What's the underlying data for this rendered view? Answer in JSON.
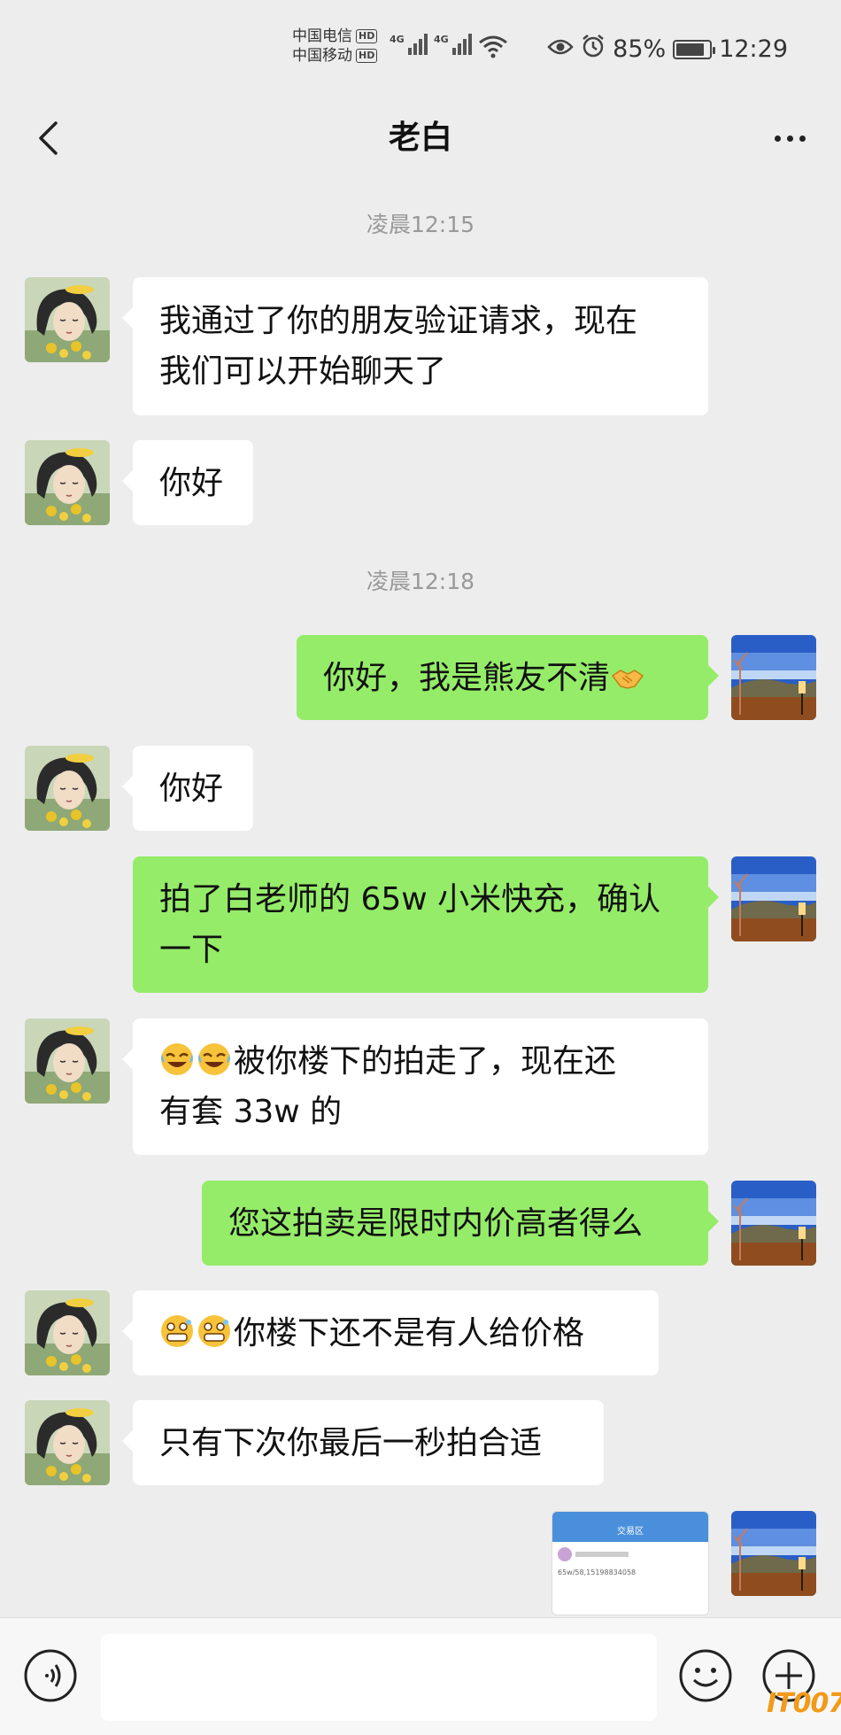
{
  "status_bar": {
    "carrier1": "中国电信",
    "carrier2": "中国移动",
    "hd_badge": "HD",
    "network": "4G",
    "battery": "85%",
    "battery_level": 0.85,
    "time": "12:29"
  },
  "header": {
    "title": "老白"
  },
  "messages": [
    {
      "type": "time",
      "text": "凌晨12:15"
    },
    {
      "type": "in",
      "text": "我通过了你的朋友验证请求，现在\n我们可以开始聊天了"
    },
    {
      "type": "in",
      "text": "你好"
    },
    {
      "type": "time",
      "text": "凌晨12:18"
    },
    {
      "type": "out",
      "text": "你好，我是熊友不清",
      "emoji_after": "handshake-emoji"
    },
    {
      "type": "in",
      "text": "你好"
    },
    {
      "type": "out",
      "text": "拍了白老师的 65w 小米快充，确认\n一下"
    },
    {
      "type": "in",
      "emoji_before": [
        "crying-laughing-emoji",
        "crying-laughing-emoji"
      ],
      "text": "被你楼下的拍走了，现在还\n有套 33w 的"
    },
    {
      "type": "out",
      "text": "您这拍卖是限时内价高者得么"
    },
    {
      "type": "in",
      "emoji_before": [
        "nervous-grin-emoji",
        "nervous-grin-emoji"
      ],
      "text": "你楼下还不是有人给价格"
    },
    {
      "type": "in",
      "text": "只有下次你最后一秒拍合适"
    },
    {
      "type": "out-image",
      "screenshot": {
        "header": "交易区",
        "line1": "65w/58,15198834058"
      }
    }
  ],
  "input_bar": {
    "placeholder": ""
  },
  "watermark": "IT007"
}
